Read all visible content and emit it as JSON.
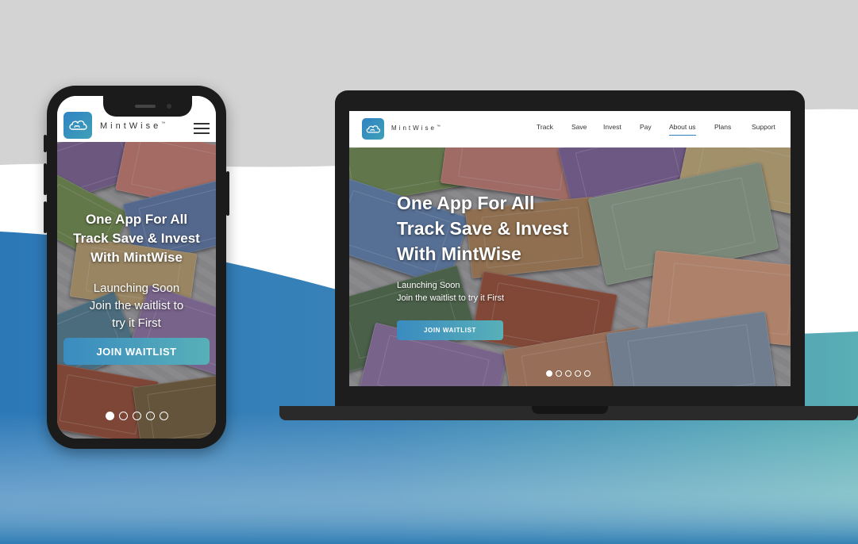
{
  "brand": {
    "name": "MintWise",
    "trademark": "™",
    "accent": "#2f83c4",
    "teal": "#58b0b8"
  },
  "hero": {
    "title_lines": [
      "One App For All",
      "Track Save & Invest",
      "With MintWise"
    ],
    "subtitle_lines": [
      "Launching Soon",
      "Join the waitlist to try it First"
    ],
    "subtitle_lines_mobile": [
      "Launching Soon",
      "Join the waitlist to",
      "try it First"
    ],
    "cta_mobile": "JOIN WAITLIST",
    "cta_desktop": "JOIN WAITLIST"
  },
  "nav": {
    "items": [
      {
        "label": "Track"
      },
      {
        "label": "Save"
      },
      {
        "label": "Invest"
      },
      {
        "label": "Pay"
      },
      {
        "label": "About us",
        "active": true
      },
      {
        "label": "Plans"
      },
      {
        "label": "Support"
      }
    ]
  },
  "carousel": {
    "slide_count": 5,
    "active_index": 0
  },
  "icons": {
    "logo": "mintwise-cloud-logo-icon",
    "menu": "hamburger-menu-icon"
  }
}
